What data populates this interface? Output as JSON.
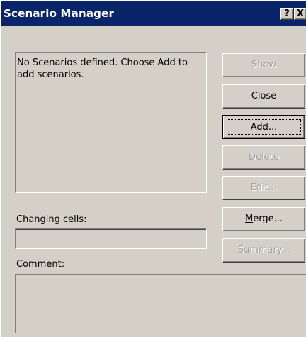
{
  "window": {
    "title": "Scenario Manager",
    "help_glyph": "?",
    "close_glyph": "X"
  },
  "scenarios": {
    "empty_message": "No Scenarios defined. Choose Add to add scenarios."
  },
  "changing_cells": {
    "label": "Changing cells:",
    "value": ""
  },
  "comment": {
    "label": "Comment:",
    "value": ""
  },
  "buttons": {
    "show": {
      "label": "Show",
      "enabled": false
    },
    "close": {
      "label": "Close",
      "enabled": true
    },
    "add": {
      "mnemonic": "A",
      "rest": "dd...",
      "enabled": true,
      "default": true
    },
    "delete": {
      "label": "Delete",
      "enabled": false
    },
    "edit": {
      "label": "Edit...",
      "enabled": false
    },
    "merge": {
      "mnemonic": "M",
      "rest": "erge...",
      "enabled": true
    },
    "summary": {
      "label": "Summary...",
      "enabled": false
    }
  },
  "colors": {
    "titlebar": "#0a246a",
    "face": "#d4d0c8",
    "disabled_text": "#a0a0a0"
  }
}
